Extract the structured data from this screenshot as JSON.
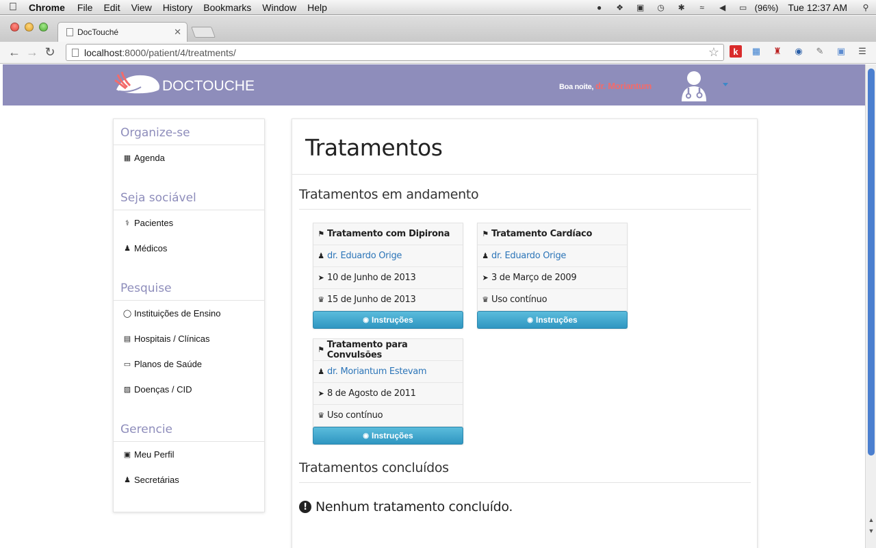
{
  "menubar": {
    "app": "Chrome",
    "items": [
      "File",
      "Edit",
      "View",
      "History",
      "Bookmarks",
      "Window",
      "Help"
    ],
    "battery": "(96%)",
    "clock": "Tue 12:37 AM"
  },
  "browser": {
    "tab_title": "DocTouché",
    "url_host": "localhost",
    "url_path": ":8000/patient/4/treatments/",
    "extensions": [
      "k"
    ]
  },
  "header": {
    "brand": "DOCTOUCHE",
    "greeting": "Boa noite,",
    "user_name": "dr. Moriantum"
  },
  "sidebar": {
    "sections": [
      {
        "title": "Organize-se",
        "items": [
          {
            "label": "Agenda",
            "icon": "calendar-icon"
          }
        ]
      },
      {
        "title": "Seja sociável",
        "items": [
          {
            "label": "Pacientes",
            "icon": "stethoscope-icon"
          },
          {
            "label": "Médicos",
            "icon": "user-md-icon"
          }
        ]
      },
      {
        "title": "Pesquise",
        "items": [
          {
            "label": "Instituições de Ensino",
            "icon": "lightbulb-icon"
          },
          {
            "label": "Hospitais / Clínicas",
            "icon": "hospital-icon"
          },
          {
            "label": "Planos de Saúde",
            "icon": "credit-card-icon"
          },
          {
            "label": "Doenças / CID",
            "icon": "medkit-icon"
          }
        ]
      },
      {
        "title": "Gerencie",
        "items": [
          {
            "label": "Meu Perfil",
            "icon": "camera-icon"
          },
          {
            "label": "Secretárias",
            "icon": "user-icon"
          }
        ]
      }
    ]
  },
  "main": {
    "title": "Tratamentos",
    "ongoing_heading": "Tratamentos em andamento",
    "completed_heading": "Tratamentos concluídos",
    "empty_message": "Nenhum tratamento concluído.",
    "button_label": "Instruções",
    "treatments": [
      {
        "name": "Tratamento com Dipirona",
        "doctor": "dr. Eduardo Orige",
        "start": "10 de Junho de 2013",
        "end": "15 de Junho de 2013"
      },
      {
        "name": "Tratamento Cardíaco",
        "doctor": "dr. Eduardo Orige",
        "start": "3 de Março de 2009",
        "end": "Uso contínuo"
      },
      {
        "name": "Tratamento para Convulsões",
        "doctor": "dr. Moriantum Estevam",
        "start": "8 de Agosto de 2011",
        "end": "Uso contínuo"
      }
    ]
  },
  "colors": {
    "header": "#8e8dbb",
    "accent_name": "#f26b6b",
    "link": "#2c75b8",
    "button": "#3aa3cc"
  }
}
